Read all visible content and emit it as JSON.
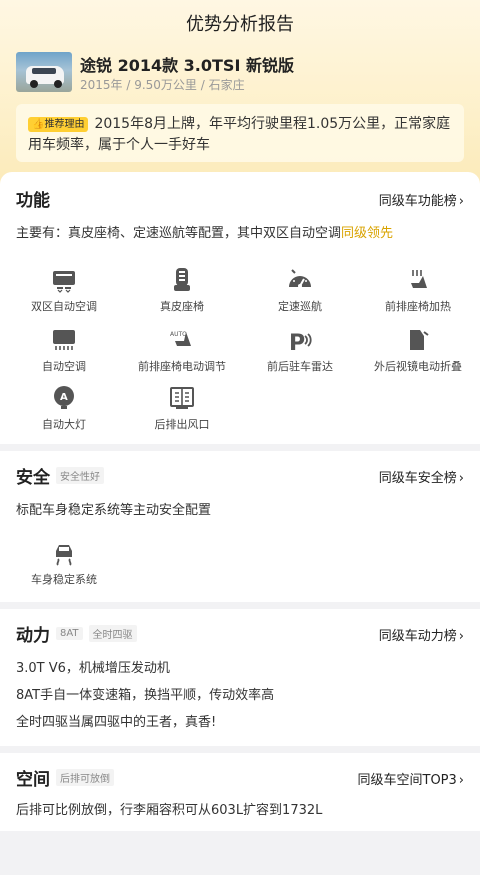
{
  "page": {
    "title": "优势分析报告"
  },
  "car": {
    "name": "途锐 2014款 3.0TSI 新锐版",
    "meta": "2015年 / 9.50万公里 / 石家庄"
  },
  "reason": {
    "badge": "推荐理由",
    "text": "2015年8月上牌，年平均行驶里程1.05万公里，正常家庭用车频率，属于个人一手好车"
  },
  "features": {
    "title": "功能",
    "rank_link": "同级车功能榜",
    "summary_prefix": "主要有：真皮座椅、定速巡航等配置，其中双区自动空调",
    "summary_highlight": "同级领先",
    "items": [
      {
        "label": "双区自动空调",
        "icon": "dual-zone-ac-icon"
      },
      {
        "label": "真皮座椅",
        "icon": "leather-seat-icon"
      },
      {
        "label": "定速巡航",
        "icon": "cruise-control-icon"
      },
      {
        "label": "前排座椅加热",
        "icon": "seat-heating-icon"
      },
      {
        "label": "自动空调",
        "icon": "auto-ac-icon"
      },
      {
        "label": "前排座椅电动调节",
        "icon": "power-seat-icon"
      },
      {
        "label": "前后驻车雷达",
        "icon": "parking-radar-icon"
      },
      {
        "label": "外后视镜电动折叠",
        "icon": "mirror-fold-icon"
      },
      {
        "label": "自动大灯",
        "icon": "auto-headlight-icon"
      },
      {
        "label": "后排出风口",
        "icon": "rear-vent-icon"
      }
    ],
    "icon_glyphs": {
      "auto": "AUTO",
      "a": "A",
      "p": "P"
    }
  },
  "safety": {
    "title": "安全",
    "tag": "安全性好",
    "rank_link": "同级车安全榜",
    "summary": "标配车身稳定系统等主动安全配置",
    "items": [
      {
        "label": "车身稳定系统",
        "icon": "stability-control-icon"
      }
    ]
  },
  "power": {
    "title": "动力",
    "tags": [
      "8AT",
      "全时四驱"
    ],
    "rank_link": "同级车动力榜",
    "lines": [
      "3.0T V6，机械增压发动机",
      "8AT手自一体变速箱，换挡平顺，传动效率高",
      "全时四驱当属四驱中的王者，真香!"
    ]
  },
  "space": {
    "title": "空间",
    "tag": "后排可放倒",
    "rank_link": "同级车空间TOP3",
    "summary": "后排可比例放倒，行李厢容积可从603L扩容到1732L"
  },
  "colors": {
    "accent": "#d9a300",
    "badge": "#ffcf33",
    "icon": "#555555"
  }
}
